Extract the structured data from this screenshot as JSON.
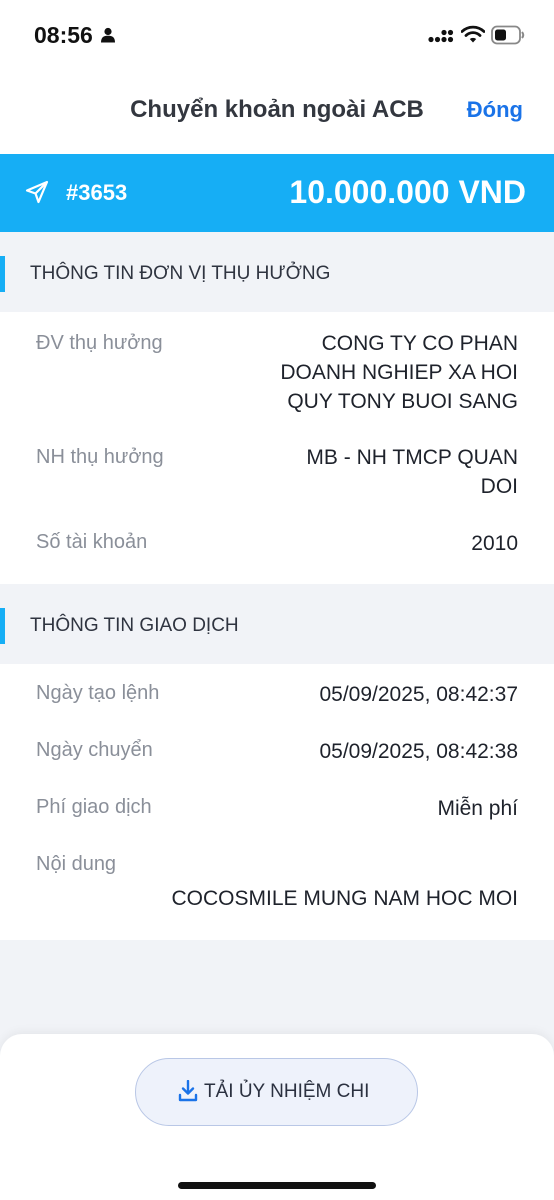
{
  "status_bar": {
    "time": "08:56"
  },
  "nav": {
    "title": "Chuyển khoản ngoài ACB",
    "close_label": "Đóng"
  },
  "banner": {
    "transaction_id": "#3653",
    "amount": "10.000.000 VND",
    "color": "#16aef5"
  },
  "beneficiary": {
    "title": "THÔNG TIN ĐƠN VỊ THỤ HƯỞNG",
    "rows": [
      {
        "label": "ĐV thụ hưởng",
        "value_lines": [
          "CONG TY CO PHAN",
          "DOANH NGHIEP XA HOI",
          "QUY TONY BUOI SANG"
        ]
      },
      {
        "label": "NH thụ hưởng",
        "value_lines": [
          "MB - NH TMCP QUAN",
          "DOI"
        ]
      },
      {
        "label": "Số tài khoản",
        "value": "2010"
      }
    ]
  },
  "transaction": {
    "title": "THÔNG TIN GIAO DỊCH",
    "rows": [
      {
        "label": "Ngày tạo lệnh",
        "value": "05/09/2025, 08:42:37"
      },
      {
        "label": "Ngày chuyển",
        "value": "05/09/2025, 08:42:38"
      },
      {
        "label": "Phí giao dịch",
        "value": "Miễn phí"
      },
      {
        "label": "Nội dung",
        "value": "COCOSMILE MUNG NAM HOC MOI"
      }
    ]
  },
  "footer": {
    "download_label": "TẢI ỦY NHIỆM CHI"
  },
  "icons": [
    "person-icon",
    "signal-icon",
    "wifi-icon",
    "battery-icon",
    "send-icon",
    "download-icon"
  ]
}
